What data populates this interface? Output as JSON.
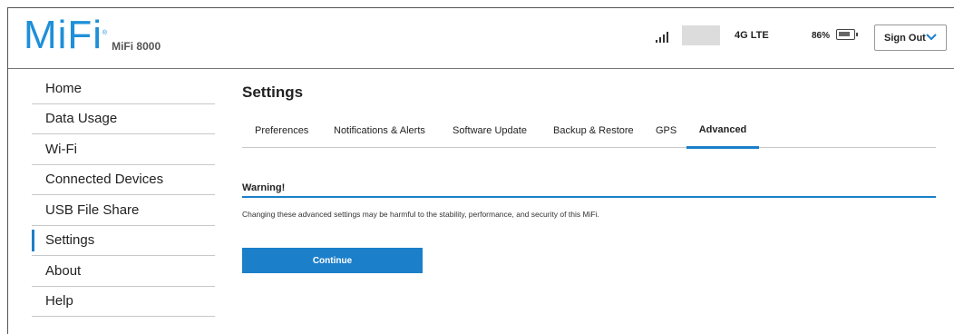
{
  "header": {
    "logo_text": "MiFi",
    "logo_tm": "®",
    "model": "MiFi 8000",
    "network_type": "4G LTE",
    "battery_percent": "86%",
    "battery_level": 0.86,
    "signal_bars": 4,
    "sign_out_label": "Sign Out"
  },
  "sidebar": {
    "items": [
      {
        "label": "Home",
        "active": false
      },
      {
        "label": "Data Usage",
        "active": false
      },
      {
        "label": "Wi-Fi",
        "active": false
      },
      {
        "label": "Connected Devices",
        "active": false
      },
      {
        "label": "USB File Share",
        "active": false
      },
      {
        "label": "Settings",
        "active": true
      },
      {
        "label": "About",
        "active": false
      },
      {
        "label": "Help",
        "active": false
      }
    ]
  },
  "main": {
    "title": "Settings",
    "tabs": [
      {
        "label": "Preferences",
        "active": false
      },
      {
        "label": "Notifications & Alerts",
        "active": false
      },
      {
        "label": "Software Update",
        "active": false
      },
      {
        "label": "Backup & Restore",
        "active": false
      },
      {
        "label": "GPS",
        "active": false
      },
      {
        "label": "Advanced",
        "active": true
      }
    ],
    "warning_title": "Warning!",
    "warning_text": "Changing these advanced settings may be harmful to the stability, performance, and security of this MiFi.",
    "continue_label": "Continue"
  },
  "colors": {
    "accent": "#1c7fc9",
    "logo": "#1e8fd8"
  },
  "icons": {
    "signal": "signal-bars-icon",
    "battery": "battery-icon",
    "chevron": "chevron-down-icon"
  }
}
